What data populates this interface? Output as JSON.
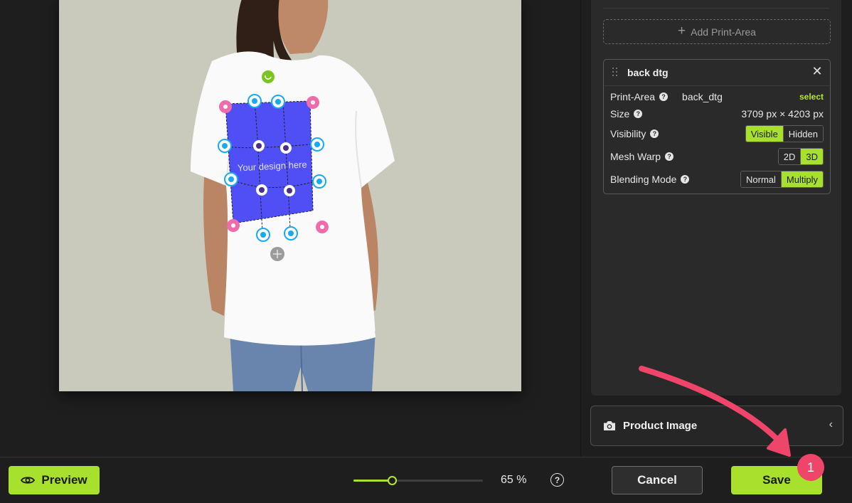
{
  "canvas": {
    "design_placeholder": "Your design here"
  },
  "layers": {
    "add_print_area_label": "Add Print-Area",
    "card": {
      "title": "back dtg",
      "close_label": "✕",
      "print_area_label": "Print-Area",
      "print_area_value": "back_dtg",
      "select_label": "select",
      "size_label": "Size",
      "size_value": "3709 px × 4203 px",
      "visibility_label": "Visibility",
      "visibility_options": [
        "Visible",
        "Hidden"
      ],
      "visibility_selected": "Visible",
      "mesh_warp_label": "Mesh Warp",
      "mesh_warp_options": [
        "2D",
        "3D"
      ],
      "mesh_warp_selected": "3D",
      "blending_label": "Blending Mode",
      "blending_options": [
        "Normal",
        "Multiply"
      ],
      "blending_selected": "Multiply",
      "help_glyph": "?"
    }
  },
  "product_image_section": {
    "label": "Product Image",
    "icon": "camera-icon",
    "chevron": "‹"
  },
  "toolbar": {
    "preview_label": "Preview",
    "zoom_value": "65 %",
    "zoom_fraction": 0.3,
    "zoom_help": "?",
    "cancel_label": "Cancel",
    "save_label": "Save"
  },
  "annotation": {
    "step_number": "1"
  },
  "colors": {
    "accent": "#a8e02e",
    "annotation": "#f0456a",
    "design_area": "#4f4ff5",
    "handle_pink": "#f06bab",
    "handle_blue": "#19a9f0",
    "rotate_green": "#7cc41f"
  }
}
